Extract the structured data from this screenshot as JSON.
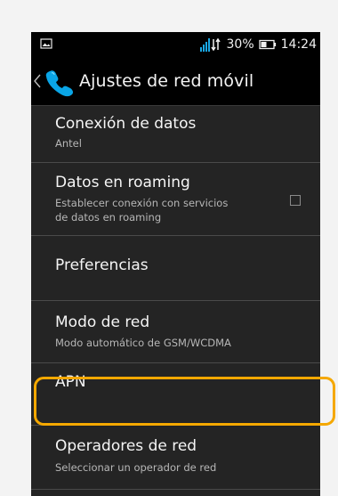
{
  "status_bar": {
    "battery_percent": "30%",
    "time": "14:24",
    "icons": [
      "image-notification-icon",
      "signal-icon",
      "battery-icon"
    ]
  },
  "action_bar": {
    "title": "Ajustes de red móvil",
    "icons": [
      "back-icon",
      "phone-icon"
    ]
  },
  "settings": {
    "items": [
      {
        "title": "Conexión de datos",
        "summary": "Antel"
      },
      {
        "title": "Datos en roaming",
        "summary": "Establecer conexión con servicios\nde datos en roaming",
        "checked": false
      },
      {
        "title": "Preferencias"
      },
      {
        "title": "Modo de red",
        "summary": "Modo automático de GSM/WCDMA"
      },
      {
        "title": "APN"
      },
      {
        "title": "Operadores de red",
        "summary": "Seleccionar un operador de red"
      }
    ]
  },
  "highlight": {
    "color": "#f5a800",
    "target": "APN"
  },
  "colors": {
    "phone_background": "#242424",
    "system_bar": "#000000",
    "phone_icon_blue": "#0aa5e6"
  }
}
